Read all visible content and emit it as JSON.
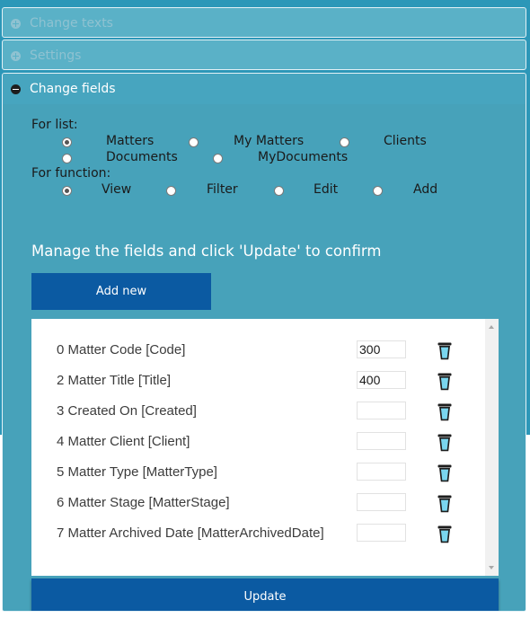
{
  "panels": {
    "change_texts": "Change texts",
    "settings": "Settings",
    "change_fields": "Change fields"
  },
  "for_list": {
    "label": "For list:",
    "options": [
      "Matters",
      "My Matters",
      "Clients",
      "Documents",
      "MyDocuments"
    ],
    "selected": "Matters"
  },
  "for_function": {
    "label": "For function:",
    "options": [
      "View",
      "Filter",
      "Edit",
      "Add"
    ],
    "selected": "View"
  },
  "manage_text": "Manage the fields and click 'Update' to confirm",
  "add_new_label": "Add new",
  "update_label": "Update",
  "fields": [
    {
      "name": "0 Matter Code [Code]",
      "width": "300"
    },
    {
      "name": "2 Matter Title [Title]",
      "width": "400"
    },
    {
      "name": "3 Created On [Created]",
      "width": ""
    },
    {
      "name": "4 Matter Client [Client]",
      "width": ""
    },
    {
      "name": "5 Matter Type [MatterType]",
      "width": ""
    },
    {
      "name": "6 Matter Stage [MatterStage]",
      "width": ""
    },
    {
      "name": "7 Matter Archived Date [MatterArchivedDate]",
      "width": ""
    }
  ],
  "icons": {
    "collapsed": "plus-circle-icon",
    "expanded": "minus-circle-icon",
    "delete": "trash-icon"
  },
  "colors": {
    "button": "#0b5aa2",
    "panel": "#47a2ba",
    "trash": "#7ad6ef"
  }
}
